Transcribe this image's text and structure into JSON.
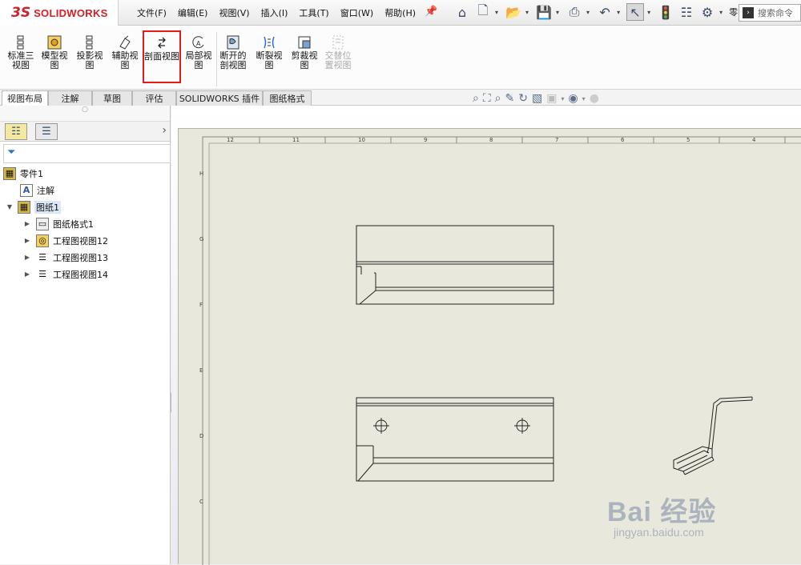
{
  "app": {
    "name": "SOLIDWORKS",
    "logo_mark": "3S"
  },
  "menu": [
    "文件(F)",
    "编辑(E)",
    "视图(V)",
    "插入(I)",
    "工具(T)",
    "窗口(W)",
    "帮助(H)"
  ],
  "search": {
    "placeholder": "搜索命令"
  },
  "quickbar": {
    "more": "零..."
  },
  "ribbon": {
    "buttons": [
      {
        "id": "standard",
        "label": "标准三视图"
      },
      {
        "id": "model",
        "label": "模型视图"
      },
      {
        "id": "projected",
        "label": "投影视图"
      },
      {
        "id": "auxiliary",
        "label": "辅助视图"
      },
      {
        "id": "section",
        "label": "剖面视图",
        "highlighted": true
      },
      {
        "id": "detail",
        "label": "局部视图"
      },
      {
        "id": "broken-out",
        "label": "断开的剖视图"
      },
      {
        "id": "break",
        "label": "断裂视图"
      },
      {
        "id": "crop",
        "label": "剪裁视图"
      },
      {
        "id": "alternate",
        "label": "交替位置视图",
        "disabled": true
      }
    ]
  },
  "tabs": [
    "视图布局",
    "注解",
    "草图",
    "评估",
    "SOLIDWORKS 插件",
    "图纸格式"
  ],
  "tree": {
    "root": "零件1",
    "annotations": "注解",
    "sheet": "图纸1",
    "children": [
      "图纸格式1",
      "工程图视图12",
      "工程图视图13",
      "工程图视图14"
    ]
  },
  "sheet": {
    "top_zones": [
      "12",
      "11",
      "10",
      "9",
      "8",
      "7",
      "6",
      "5",
      "4"
    ],
    "side_zones": [
      "H",
      "G",
      "F",
      "E",
      "D",
      "C"
    ]
  },
  "watermark": {
    "main": "Bai 经验",
    "url": "jingyan.baidu.com"
  },
  "colors": {
    "brand": "#d31f26",
    "highlight_box": "#e31b1b",
    "sheet_bg": "#e9e8dc"
  }
}
